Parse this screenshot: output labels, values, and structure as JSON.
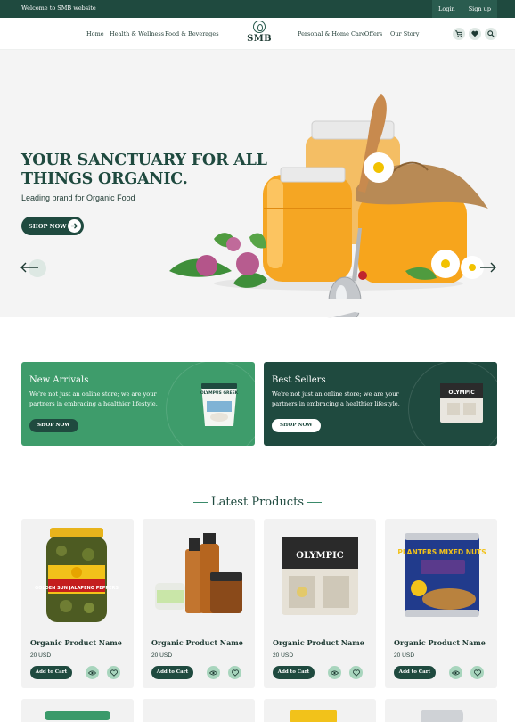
{
  "topbar": {
    "welcome": "Welcome to SMB website",
    "login": "Login",
    "signup": "Sign up"
  },
  "nav": {
    "left_links": [
      "Home",
      "Health & Wellness",
      "Food & Beverages"
    ],
    "logo": "SMB",
    "right_links": [
      "Personal & Home Care",
      "Offers",
      "Our Story"
    ],
    "icons": [
      "cart-icon",
      "heart-icon",
      "search-icon"
    ]
  },
  "hero": {
    "heading": "YOUR SANCTUARY FOR ALL THINGS ORGANIC.",
    "subtitle": "Leading brand for Organic Food",
    "cta": "SHOP NOW",
    "prev_icon": "arrow-left-icon",
    "next_icon": "arrow-right-icon"
  },
  "promos": [
    {
      "title": "New Arrivals",
      "desc": "We're not just an online store; we are your partners in embracing a healthier lifestyle.",
      "cta": "SHOP NOW",
      "product_label": "OLYMPUS GREEK"
    },
    {
      "title": "Best Sellers",
      "desc": "We're not just an online store; we are your partners in embracing a healthier lifestyle.",
      "cta": "SHOP NOW",
      "product_label": "OLYMPIC"
    }
  ],
  "latest": {
    "title": "Latest Products",
    "products": [
      {
        "name": "Organic Product Name",
        "price": "20 USD",
        "add": "Add to Cart",
        "label": "GOLDEN SUN JALAPENO PEPPERS"
      },
      {
        "name": "Organic Product Name",
        "price": "20 USD",
        "add": "Add to Cart",
        "label": ""
      },
      {
        "name": "Organic Product Name",
        "price": "20 USD",
        "add": "Add to Cart",
        "label": "OLYMPIC"
      },
      {
        "name": "Organic Product Name",
        "price": "20 USD",
        "add": "Add to Cart",
        "label": "PLANTERS MIXED NUTS"
      }
    ]
  },
  "colors": {
    "brand": "#1f4a3f",
    "accent": "#3a9a6a",
    "mint": "#a8d5bd",
    "light_bg": "#f2f2f2"
  }
}
